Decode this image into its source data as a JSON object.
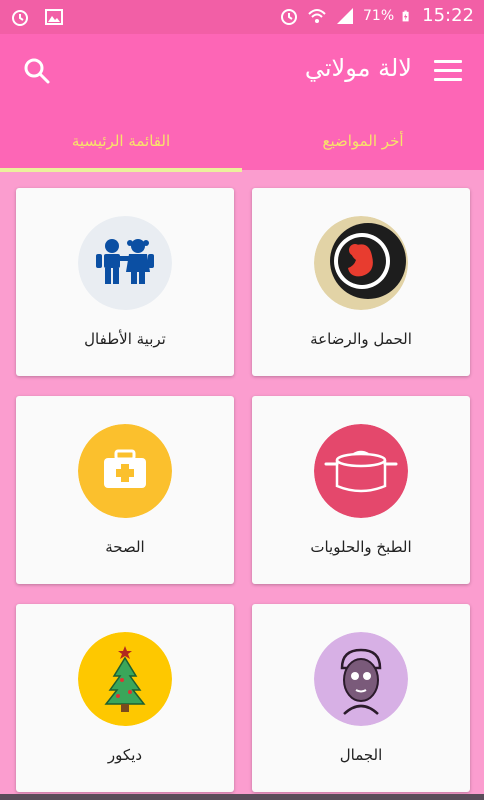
{
  "status_bar": {
    "battery": "71%",
    "time": "15:22"
  },
  "app_bar": {
    "title": "لالة مولاتي",
    "menu_icon": "menu-icon",
    "search_icon": "search-icon"
  },
  "tabs": [
    {
      "label": "أخر المواضيع",
      "active": false
    },
    {
      "label": "القائمة الرئيسية",
      "active": true
    }
  ],
  "categories": [
    {
      "label": "الحمل  والرضاعة",
      "icon": "fetus-icon",
      "color": "#e2d3a6"
    },
    {
      "label": "تربية الأطفال",
      "icon": "children-icon",
      "color": "#e9edf2"
    },
    {
      "label": "الطبخ والحلويات",
      "icon": "cooking-pot-icon",
      "color": "#e4486c"
    },
    {
      "label": "الصحة",
      "icon": "first-aid-kit-icon",
      "color": "#fbc02d"
    },
    {
      "label": "الجمال",
      "icon": "face-mask-icon",
      "color": "#d7b0e5"
    },
    {
      "label": "ديكور",
      "icon": "christmas-tree-icon",
      "color": "#fec800"
    }
  ],
  "colors": {
    "status_bar": "#f25fa6",
    "app_bar": "#fd66b6",
    "background": "#fb9dcf",
    "tab_text": "#f7e46a"
  }
}
